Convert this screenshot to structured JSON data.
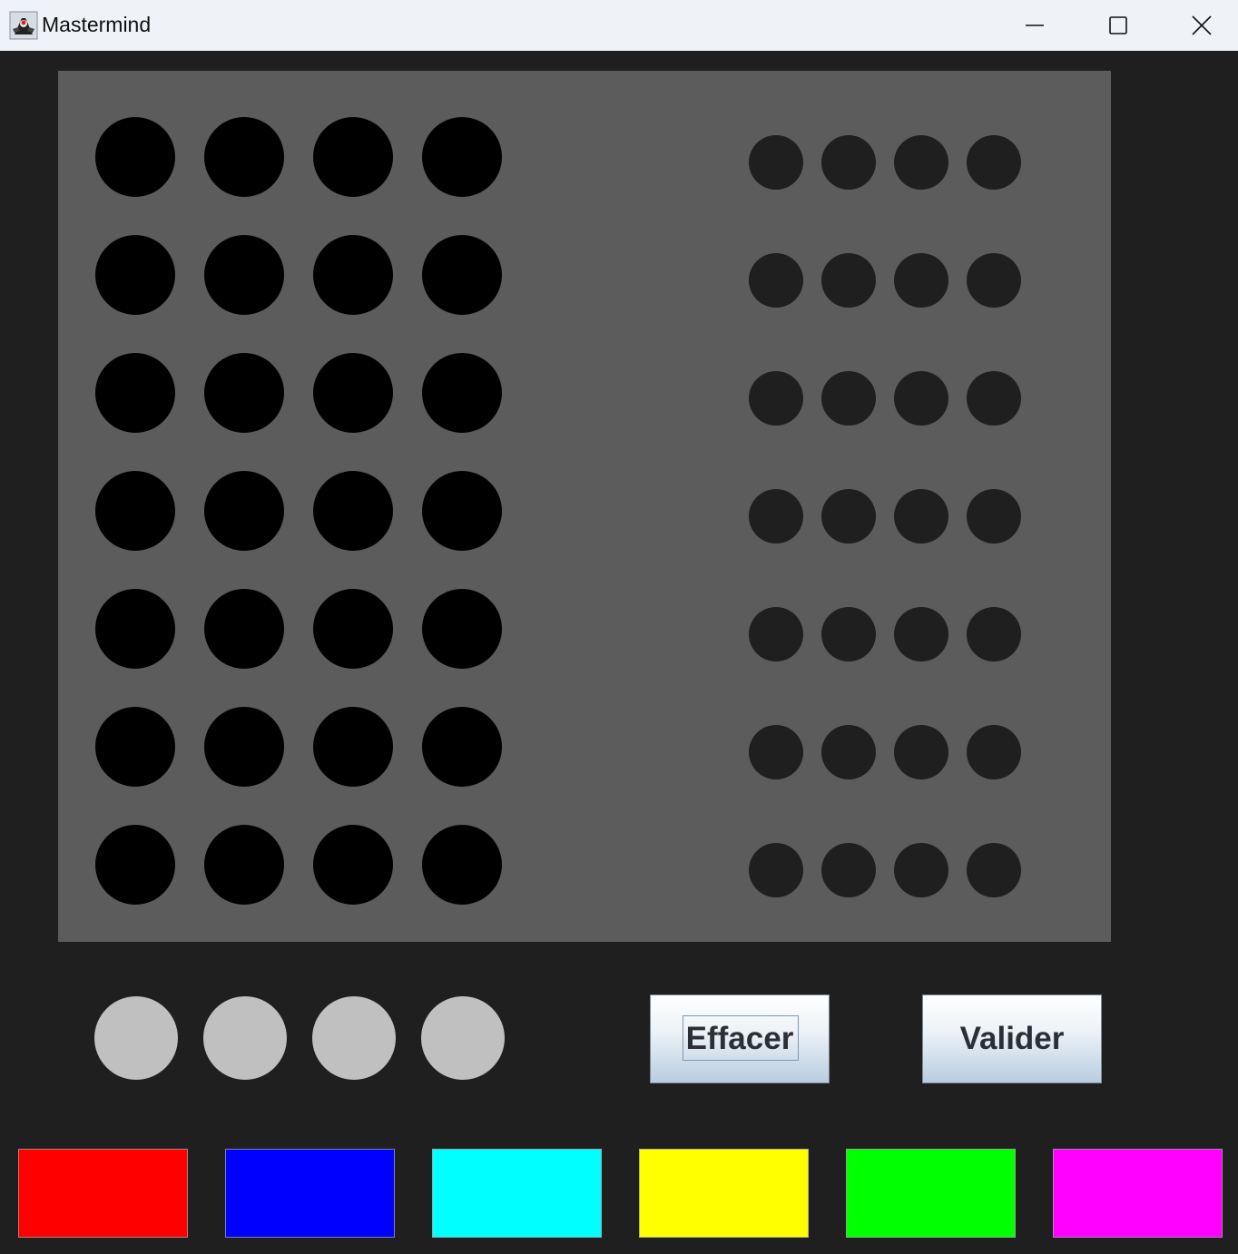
{
  "window": {
    "title": "Mastermind",
    "icon": "java-duke-icon",
    "controls": [
      "minimize-icon",
      "maximize-icon",
      "close-icon"
    ]
  },
  "board": {
    "rows": 7,
    "pegs_per_row": 4,
    "peg_color": "#000000",
    "hint_color": "#1f1f1f",
    "background": "#5c5c5c"
  },
  "current_guess": {
    "slots": 4,
    "color": "#c0c0c0"
  },
  "buttons": {
    "clear_label": "Effacer",
    "validate_label": "Valider"
  },
  "palette": [
    {
      "name": "red",
      "color": "#ff0000"
    },
    {
      "name": "blue",
      "color": "#0000ff"
    },
    {
      "name": "cyan",
      "color": "#00ffff"
    },
    {
      "name": "yellow",
      "color": "#ffff00"
    },
    {
      "name": "green",
      "color": "#00ff00"
    },
    {
      "name": "magenta",
      "color": "#ff00ff"
    }
  ]
}
